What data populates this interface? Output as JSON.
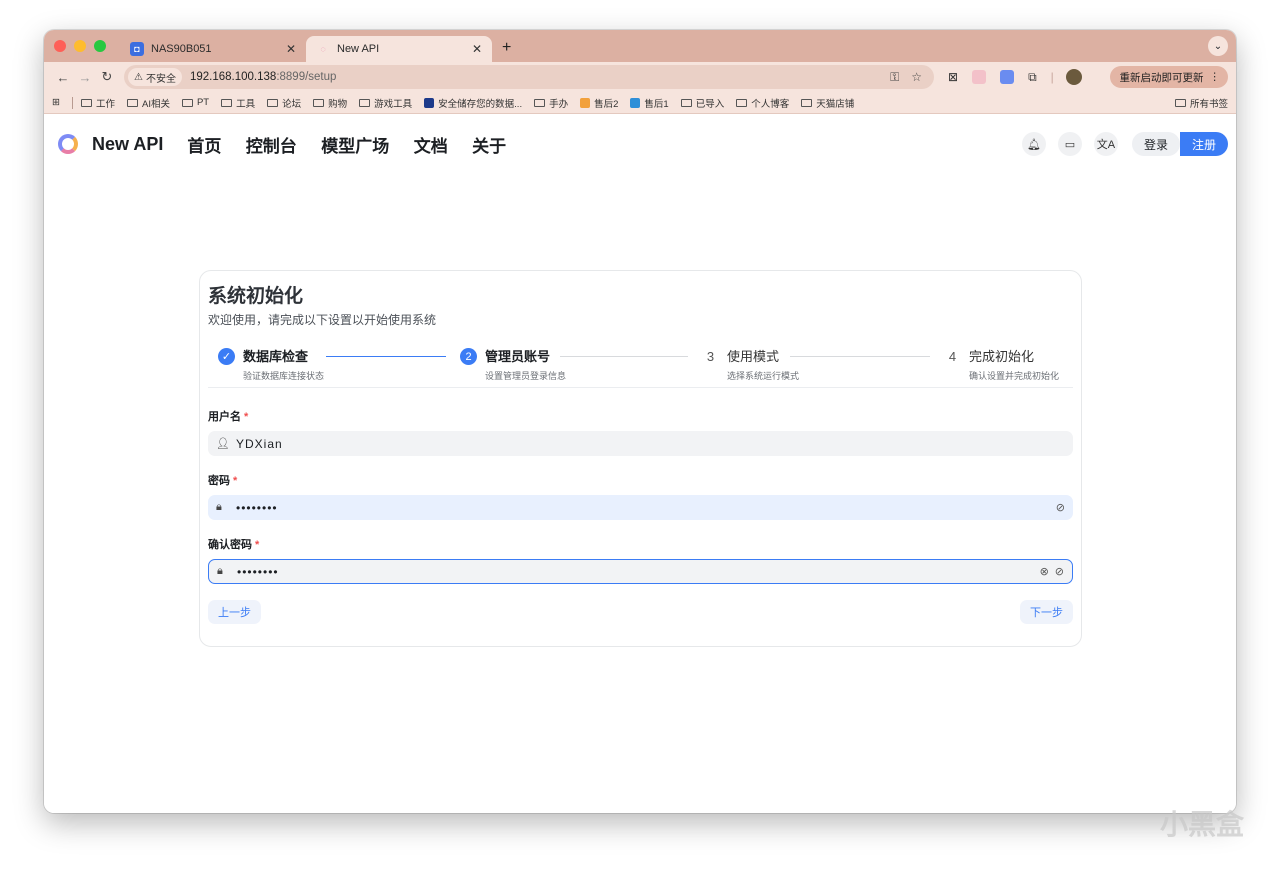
{
  "browser": {
    "tabs": [
      {
        "title": "NAS90B051",
        "favicon_color": "#3c6ee0",
        "active": false
      },
      {
        "title": "New API",
        "favicon_color": "#e87ea7",
        "active": true
      }
    ],
    "new_tab": "+",
    "address": {
      "security_label": "不安全",
      "host": "192.168.100.138",
      "port_path": ":8899/setup"
    },
    "update_label": "重新启动即可更新",
    "bookmarks": [
      {
        "label": "工作",
        "type": "folder"
      },
      {
        "label": "AI相关",
        "type": "folder"
      },
      {
        "label": "PT",
        "type": "folder"
      },
      {
        "label": "工具",
        "type": "folder"
      },
      {
        "label": "论坛",
        "type": "folder"
      },
      {
        "label": "购物",
        "type": "folder"
      },
      {
        "label": "游戏工具",
        "type": "folder"
      },
      {
        "label": "安全储存您的数据...",
        "type": "site",
        "color": "#1d3a8a"
      },
      {
        "label": "手办",
        "type": "folder"
      },
      {
        "label": "售后2",
        "type": "site",
        "color": "#f2a03b"
      },
      {
        "label": "售后1",
        "type": "site",
        "color": "#2f8fd8"
      },
      {
        "label": "已导入",
        "type": "folder"
      },
      {
        "label": "个人博客",
        "type": "folder"
      },
      {
        "label": "天猫店铺",
        "type": "folder"
      }
    ],
    "all_bookmarks": "所有书签"
  },
  "app": {
    "brand": "New API",
    "nav": [
      "首页",
      "控制台",
      "模型广场",
      "文档",
      "关于"
    ],
    "login": "登录",
    "register": "注册"
  },
  "setup": {
    "title": "系统初始化",
    "subtitle": "欢迎使用，请完成以下设置以开始使用系统",
    "steps": [
      {
        "num": "✓",
        "title": "数据库检查",
        "desc": "验证数据库连接状态",
        "state": "done"
      },
      {
        "num": "2",
        "title": "管理员账号",
        "desc": "设置管理员登录信息",
        "state": "active"
      },
      {
        "num": "3",
        "title": "使用模式",
        "desc": "选择系统运行模式",
        "state": "wait"
      },
      {
        "num": "4",
        "title": "完成初始化",
        "desc": "确认设置并完成初始化",
        "state": "wait"
      }
    ],
    "fields": {
      "username": {
        "label": "用户名",
        "value": "YDXian"
      },
      "password": {
        "label": "密码",
        "value": "••••••••"
      },
      "confirm": {
        "label": "确认密码",
        "value": "••••••••"
      }
    },
    "prev": "上一步",
    "next": "下一步"
  },
  "watermark": "小黑盒",
  "colors": {
    "accent": "#3b7cf5",
    "tabstrip": "#dcb0a2",
    "toolbar": "#f6e4dd"
  }
}
